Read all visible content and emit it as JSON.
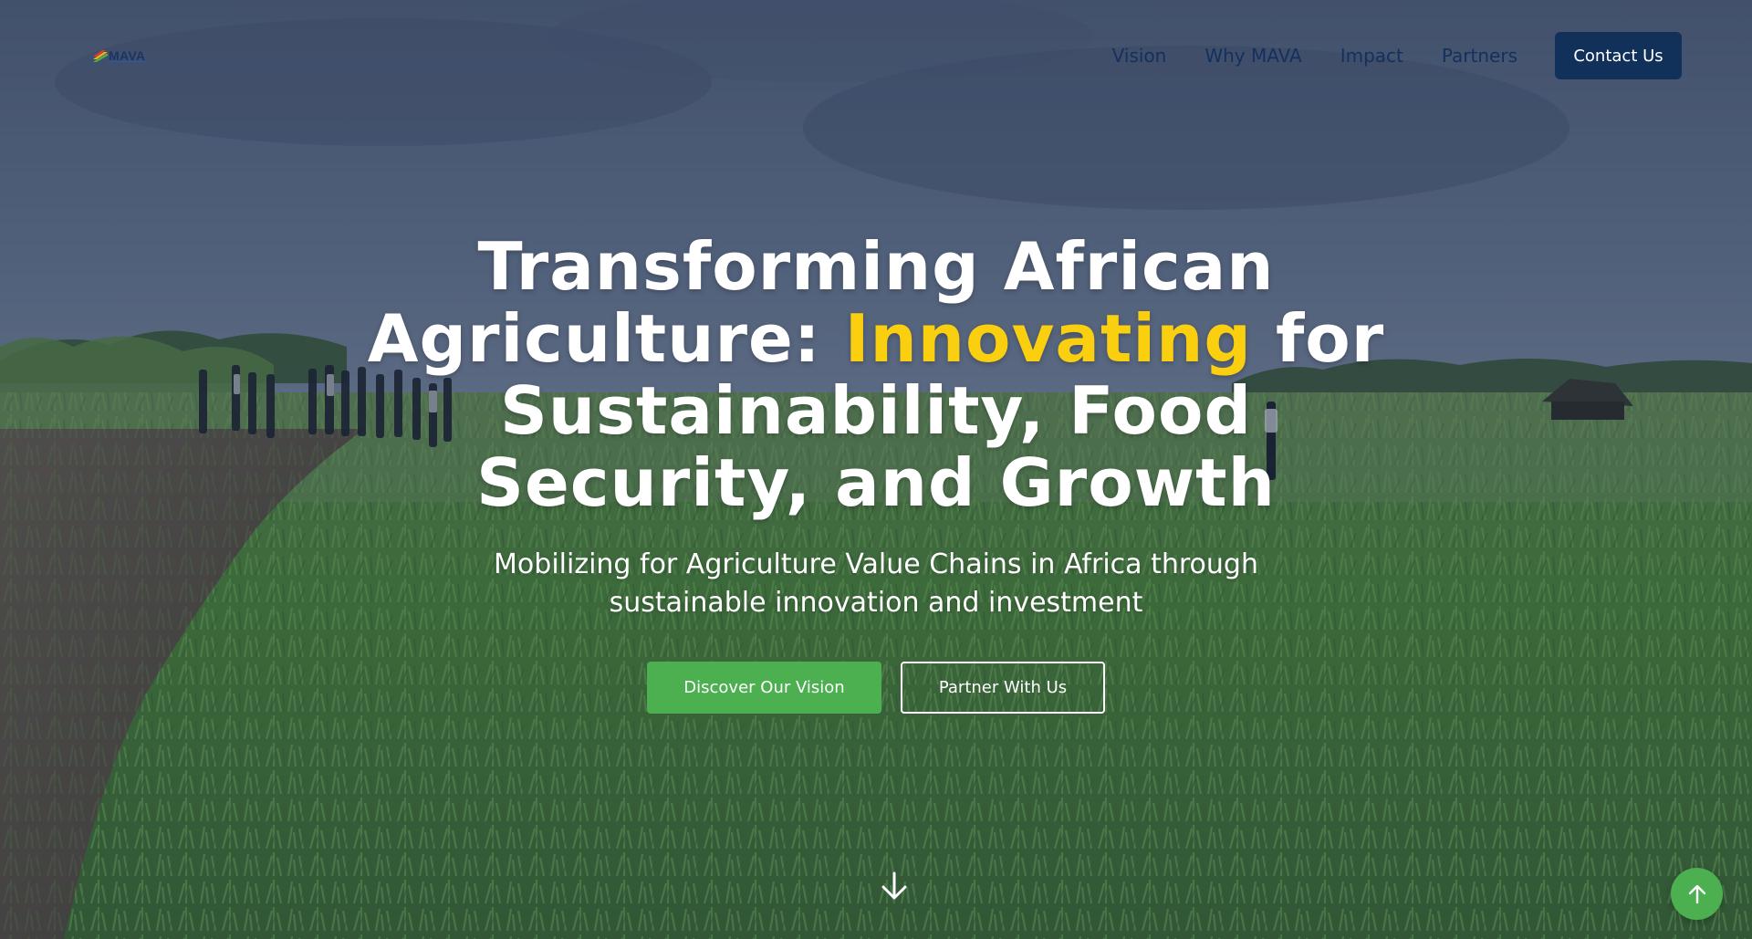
{
  "brand": {
    "logo_text": "MAVA",
    "logo_icon": "mava-stripes-logo-icon"
  },
  "nav": {
    "items": [
      {
        "label": "Vision"
      },
      {
        "label": "Why MAVA"
      },
      {
        "label": "Impact"
      },
      {
        "label": "Partners"
      }
    ],
    "cta_label": "Contact Us"
  },
  "hero": {
    "headline_before_accent": "Transforming African Agriculture: ",
    "headline_accent": "Innovating",
    "headline_after_accent": " for Sustainability, Food Security, and Growth",
    "subtitle": "Mobilizing for Agriculture Value Chains in Africa through sustainable innovation and investment",
    "primary_button": "Discover Our Vision",
    "secondary_button": "Partner With Us",
    "scroll_icon": "arrow-down-icon",
    "back_to_top_icon": "arrow-up-icon"
  },
  "colors": {
    "accent_yellow": "#f9cf0f",
    "primary_green": "#4caf50",
    "navy": "#11305a",
    "nav_text": "#14305e",
    "white": "#ffffff"
  }
}
